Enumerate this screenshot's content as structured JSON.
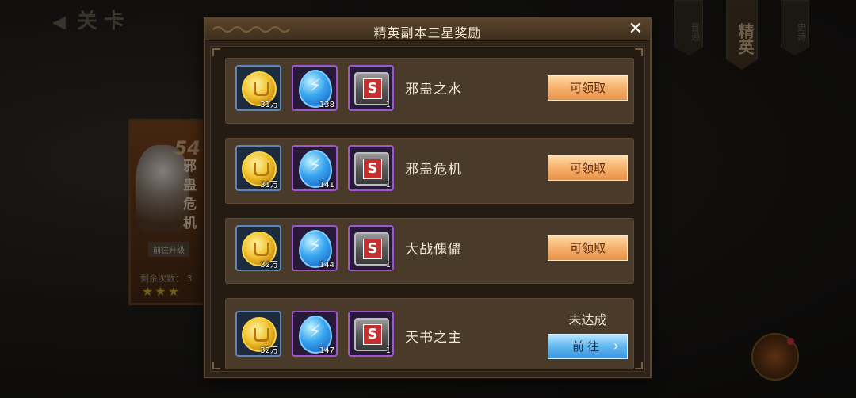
{
  "background": {
    "title": "关卡",
    "tabs": [
      "普通",
      "精英",
      "史诗"
    ],
    "level_card": {
      "number": "54",
      "name": "邪蛊危机",
      "upgrade_label": "前往升级",
      "remaining_label": "剩余次数：",
      "remaining_value": "3"
    }
  },
  "modal": {
    "title": "精英副本三星奖励",
    "close_label": "✕",
    "rows": [
      {
        "stage": "邪蛊之水",
        "gold": "31万",
        "crystal": "138",
        "chest": "1",
        "button": "可领取"
      },
      {
        "stage": "邪蛊危机",
        "gold": "31万",
        "crystal": "141",
        "chest": "1",
        "button": "可领取"
      },
      {
        "stage": "大战傀儡",
        "gold": "32万",
        "crystal": "144",
        "chest": "1",
        "button": "可领取"
      },
      {
        "stage": "天书之主",
        "gold": "32万",
        "crystal": "147",
        "chest": "1",
        "status": "未达成",
        "goto_label": "前往"
      }
    ]
  },
  "colors": {
    "claim_button": "#f6b06c",
    "goto_button": "#62b7ee",
    "row_bg": "#4a3a2a"
  }
}
